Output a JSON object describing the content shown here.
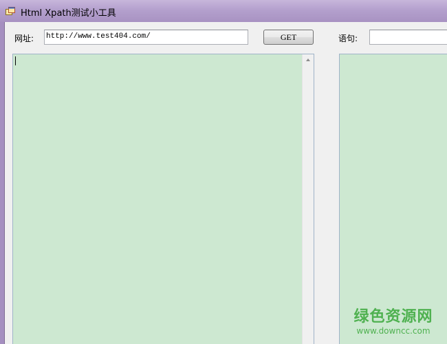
{
  "window": {
    "title": "Html Xpath测试小工具"
  },
  "form": {
    "url_label": "网址:",
    "url_value": "http://www.test404.com/",
    "get_button_label": "GET",
    "statement_label": "语句:",
    "statement_value": ""
  },
  "watermark": {
    "name": "绿色资源网",
    "url": "www.downcc.com"
  },
  "colors": {
    "pane_background": "#cde8d1",
    "watermark": "#3aa83a"
  },
  "icons": {
    "app": "app-window-icon",
    "scroll_up": "scroll-up-arrow-icon"
  }
}
